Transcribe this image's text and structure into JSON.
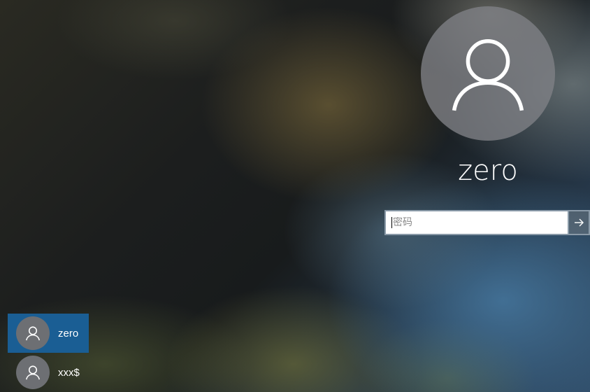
{
  "login": {
    "username": "zero",
    "password_placeholder": "密码",
    "password_value": "",
    "submit_icon": "arrow-right-icon",
    "avatar_icon": "person-icon"
  },
  "users": [
    {
      "name": "zero",
      "selected": true,
      "icon": "person-icon"
    },
    {
      "name": "xxx$",
      "selected": false,
      "icon": "person-icon"
    }
  ],
  "colors": {
    "selected_user_bg": "#1a5e94",
    "avatar_bg": "#808286",
    "input_border": "#8a9aa8"
  }
}
